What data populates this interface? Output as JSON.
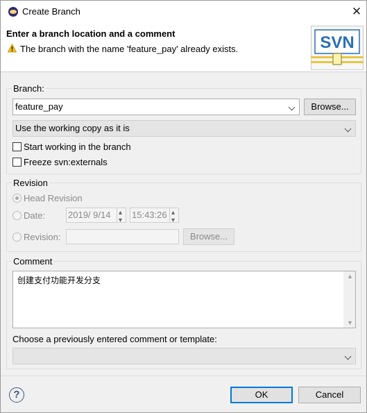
{
  "window": {
    "title": "Create Branch",
    "close_glyph": "✕",
    "icon": "eclipse-icon"
  },
  "header": {
    "title": "Enter a branch location and a comment",
    "message": "The branch with the name 'feature_pay' already exists.",
    "logo_text": "SVN"
  },
  "branch": {
    "group_label": "Branch:",
    "location_value": "feature_pay",
    "browse_label": "Browse...",
    "copy_mode_value": "Use the working copy as it is",
    "start_working_label": "Start working in the branch",
    "start_working_checked": false,
    "freeze_label": "Freeze svn:externals",
    "freeze_checked": false
  },
  "revision": {
    "group_label": "Revision",
    "head_label": "Head Revision",
    "head_selected": true,
    "date_label": "Date:",
    "date_value": "2019/  9/14",
    "time_value": "15:43:26",
    "revision_label": "Revision:",
    "revision_value": "",
    "browse_label": "Browse..."
  },
  "comment": {
    "group_label": "Comment",
    "text": "创建支付功能开发分支",
    "previous_label": "Choose a previously entered comment or template:",
    "previous_value": ""
  },
  "footer": {
    "help_glyph": "?",
    "ok_label": "OK",
    "cancel_label": "Cancel"
  },
  "colors": {
    "accent": "#0078d7",
    "warning": "#f3c11b",
    "svn_blue": "#2a6fb5"
  }
}
